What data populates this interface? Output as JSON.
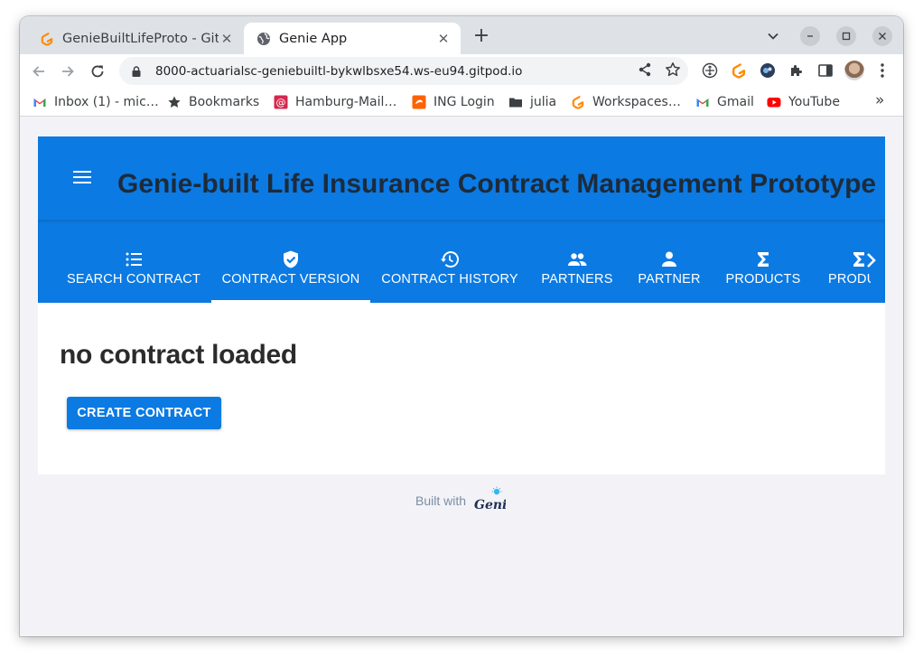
{
  "browser": {
    "tabs": [
      {
        "title": "GenieBuiltLifeProto - Gitpod",
        "close": "✕",
        "active": false
      },
      {
        "title": "Genie App",
        "close": "✕",
        "active": true
      }
    ],
    "new_tab": "+",
    "url": "8000-actuarialsc-geniebuiltl-bykwlbsxe54.ws-eu94.gitpod.io",
    "bookmarks": [
      {
        "label": "Inbox (1) - mic…",
        "icon": "gmail-icon"
      },
      {
        "label": "Bookmarks",
        "icon": "star-icon"
      },
      {
        "label": "Hamburg-Mail…",
        "icon": "mail-icon"
      },
      {
        "label": "ING Login",
        "icon": "ing-icon"
      },
      {
        "label": "julia",
        "icon": "folder-icon"
      },
      {
        "label": "Workspaces…",
        "icon": "gitpod-icon"
      },
      {
        "label": "Gmail",
        "icon": "gmail-icon"
      },
      {
        "label": "YouTube",
        "icon": "youtube-icon"
      }
    ],
    "bookmarks_more": "»"
  },
  "app": {
    "title": "Genie-built Life Insurance Contract Management Prototype",
    "tabs": [
      {
        "label": "SEARCH CONTRACT",
        "icon": "list-icon"
      },
      {
        "label": "CONTRACT VERSION",
        "icon": "verified-shield-icon",
        "active": true
      },
      {
        "label": "CONTRACT HISTORY",
        "icon": "history-icon"
      },
      {
        "label": "PARTNERS",
        "icon": "people-icon"
      },
      {
        "label": "PARTNER",
        "icon": "person-icon"
      },
      {
        "label": "PRODUCTS",
        "icon": "sigma-icon"
      },
      {
        "label": "PRODUCT",
        "icon": "sigma-icon"
      }
    ],
    "accent": "#0b7ae3"
  },
  "main": {
    "heading": "no contract loaded",
    "create_button": "CREATE CONTRACT"
  },
  "footer": {
    "built_with": "Built with",
    "logo_text": "Genie"
  }
}
